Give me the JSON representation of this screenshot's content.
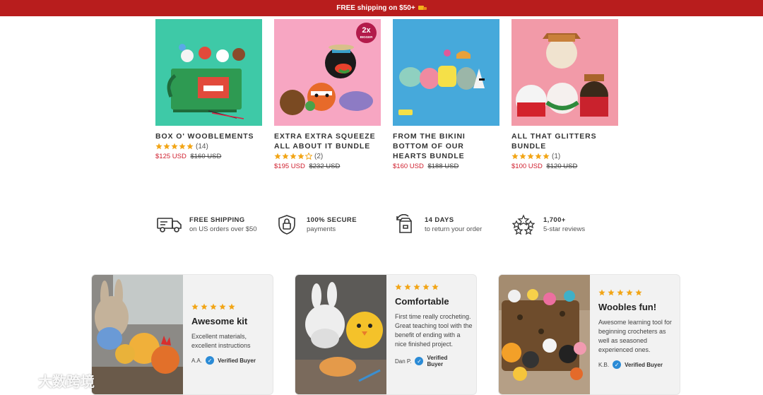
{
  "banner": {
    "text": "FREE shipping on $50+"
  },
  "products": [
    {
      "title": "BOX O' WOOBLEMENTS",
      "rating_count": "(14)",
      "stars": 5,
      "price": "$125 USD",
      "compare_price": "$160 USD",
      "bg": "#3ec9a7"
    },
    {
      "title": "EXTRA EXTRA SQUEEZE ALL ABOUT IT BUNDLE",
      "rating_count": "(2)",
      "stars": 4,
      "price": "$195 USD",
      "compare_price": "$232 USD",
      "bg": "#f7a6c2",
      "badge_top": "2x",
      "badge_bottom": "BIGGER"
    },
    {
      "title": "FROM THE BIKINI BOTTOM OF OUR HEARTS BUNDLE",
      "rating_count": "",
      "stars": 0,
      "price": "$160 USD",
      "compare_price": "$188 USD",
      "bg": "#46a9db"
    },
    {
      "title": "ALL THAT GLITTERS BUNDLE",
      "rating_count": "(1)",
      "stars": 5,
      "price": "$100 USD",
      "compare_price": "$120 USD",
      "bg": "#f29aa8"
    }
  ],
  "features": [
    {
      "heading": "FREE SHIPPING",
      "sub": "on US orders over $50",
      "icon": "truck-icon"
    },
    {
      "heading": "100% SECURE",
      "sub": "payments",
      "icon": "shield-lock-icon"
    },
    {
      "heading": "14 DAYS",
      "sub": "to return your order",
      "icon": "return-box-icon"
    },
    {
      "heading": "1,700+",
      "sub": "5-star reviews",
      "icon": "stars-icon"
    }
  ],
  "reviews": [
    {
      "title": "Awesome kit",
      "text": "Excellent materials, excellent instructions",
      "author": "A.A.",
      "verified": "Verified Buyer"
    },
    {
      "title": "Comfortable",
      "text": "First time really crocheting. Great teaching tool with the benefit of ending with a nice finished project.",
      "author": "Dan P.",
      "verified": "Verified Buyer"
    },
    {
      "title": "Woobles fun!",
      "text": "Awesome learning tool for beginning crocheters as well as seasoned experienced ones.",
      "author": "K.B.",
      "verified": "Verified Buyer"
    }
  ],
  "watermark": {
    "text": "大数跨境"
  },
  "colors": {
    "banner": "#b81d1d",
    "star": "#f2a516",
    "sale_price": "#d0202f",
    "verified": "#2b8bd6"
  }
}
